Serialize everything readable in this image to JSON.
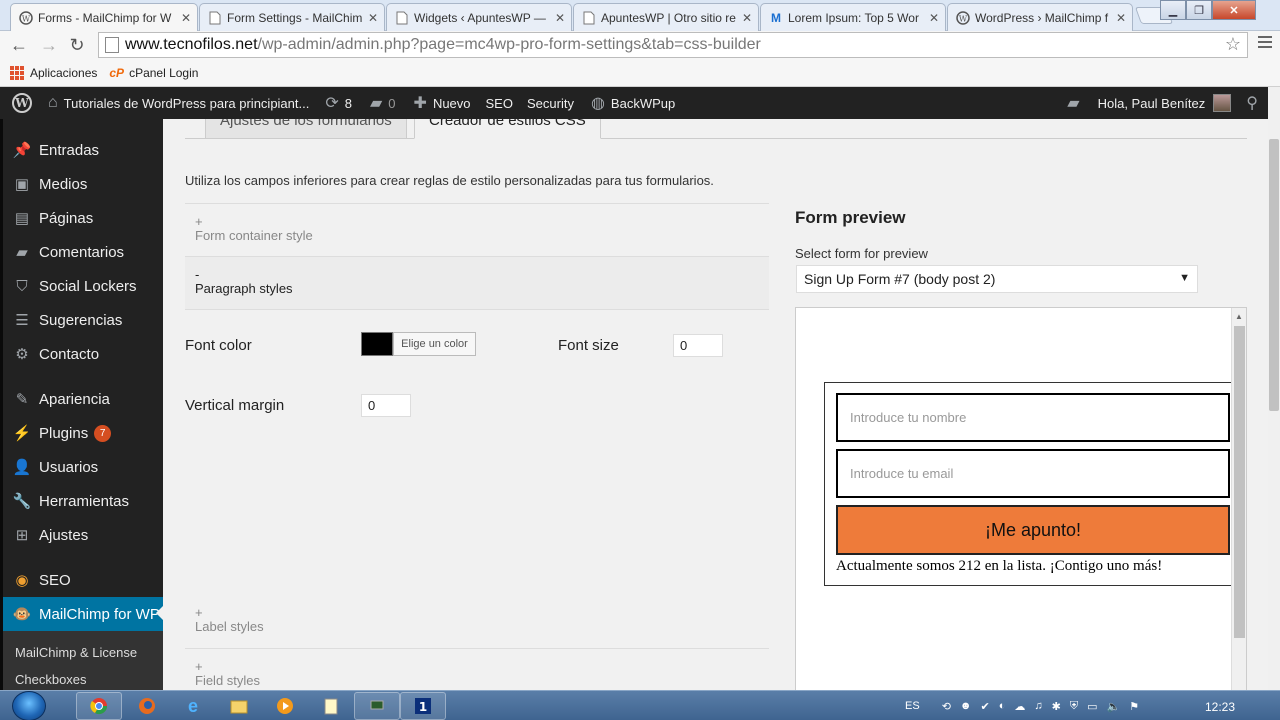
{
  "browser": {
    "tabs": [
      {
        "title": "Forms - MailChimp for W",
        "active": true
      },
      {
        "title": "Form Settings - MailChim",
        "active": false
      },
      {
        "title": "Widgets ‹ ApuntesWP —",
        "active": false
      },
      {
        "title": "ApuntesWP | Otro sitio re",
        "active": false
      },
      {
        "title": "Lorem Ipsum: Top 5 Wor",
        "active": false
      },
      {
        "title": "WordPress › MailChimp f",
        "active": false
      }
    ],
    "url_host": "www.tecnofilos.net",
    "url_path": "/wp-admin/admin.php?page=mc4wp-pro-form-settings&tab=css-builder",
    "bookmarks": [
      "Aplicaciones",
      "cPanel Login"
    ],
    "cpanel_mark": "cP"
  },
  "adminbar": {
    "site_name": "Tutoriales de WordPress para principiant...",
    "updates_count": "8",
    "comments_count": "0",
    "new_label": "Nuevo",
    "seo": "SEO",
    "security": "Security",
    "backwpup": "BackWPup",
    "greeting": "Hola, Paul Benítez"
  },
  "sidebar": {
    "items": [
      {
        "label": "Entradas",
        "icon": "pin-icon",
        "glyph": "📌"
      },
      {
        "label": "Medios",
        "icon": "media-icon",
        "glyph": "▣"
      },
      {
        "label": "Páginas",
        "icon": "pages-icon",
        "glyph": "▤"
      },
      {
        "label": "Comentarios",
        "icon": "comments-icon",
        "glyph": "▰"
      },
      {
        "label": "Social Lockers",
        "icon": "lock-shield-icon",
        "glyph": "⛉"
      },
      {
        "label": "Sugerencias",
        "icon": "list-icon",
        "glyph": "☰"
      },
      {
        "label": "Contacto",
        "icon": "gear-icon",
        "glyph": "⚙"
      },
      {
        "label": "Apariencia",
        "icon": "brush-icon",
        "glyph": "✎"
      },
      {
        "label": "Plugins",
        "icon": "plugin-icon",
        "glyph": "⚡",
        "badge": "7"
      },
      {
        "label": "Usuarios",
        "icon": "user-icon",
        "glyph": "👤"
      },
      {
        "label": "Herramientas",
        "icon": "wrench-icon",
        "glyph": "🔧"
      },
      {
        "label": "Ajustes",
        "icon": "settings-icon",
        "glyph": "⊞"
      },
      {
        "label": "SEO",
        "icon": "seo-icon",
        "glyph": "◉"
      },
      {
        "label": "MailChimp for WP",
        "icon": "mailchimp-icon",
        "glyph": "🐵"
      }
    ],
    "submenu": [
      "MailChimp & License",
      "Checkboxes"
    ]
  },
  "page": {
    "tabs": [
      "Ajustes de los formularios",
      "Creador de estilos CSS"
    ],
    "intro": "Utiliza los campos inferiores para crear reglas de estilo personalizadas para tus formularios.",
    "sections": [
      {
        "sign": "+",
        "name": "Form container style"
      },
      {
        "sign": "-",
        "name": "Paragraph styles"
      },
      {
        "sign": "+",
        "name": "Label styles"
      },
      {
        "sign": "+",
        "name": "Field styles"
      }
    ],
    "font_color_label": "Font color",
    "color_button": "Elige un color",
    "font_color_value": "#000000",
    "font_size_label": "Font size",
    "font_size_value": "0",
    "vertical_margin_label": "Vertical margin",
    "vertical_margin_value": "0"
  },
  "preview": {
    "title": "Form preview",
    "select_label": "Select form for preview",
    "selected_form": "Sign Up Form #7 (body post 2)",
    "name_placeholder": "Introduce tu nombre",
    "email_placeholder": "Introduce tu email",
    "submit_label": "¡Me apunto!",
    "subscribers_text": "Actualmente somos 212 en la lista. ¡Contigo uno más!",
    "submit_color": "#ee7b3a"
  },
  "taskbar": {
    "lang": "ES",
    "time": "12:23"
  }
}
